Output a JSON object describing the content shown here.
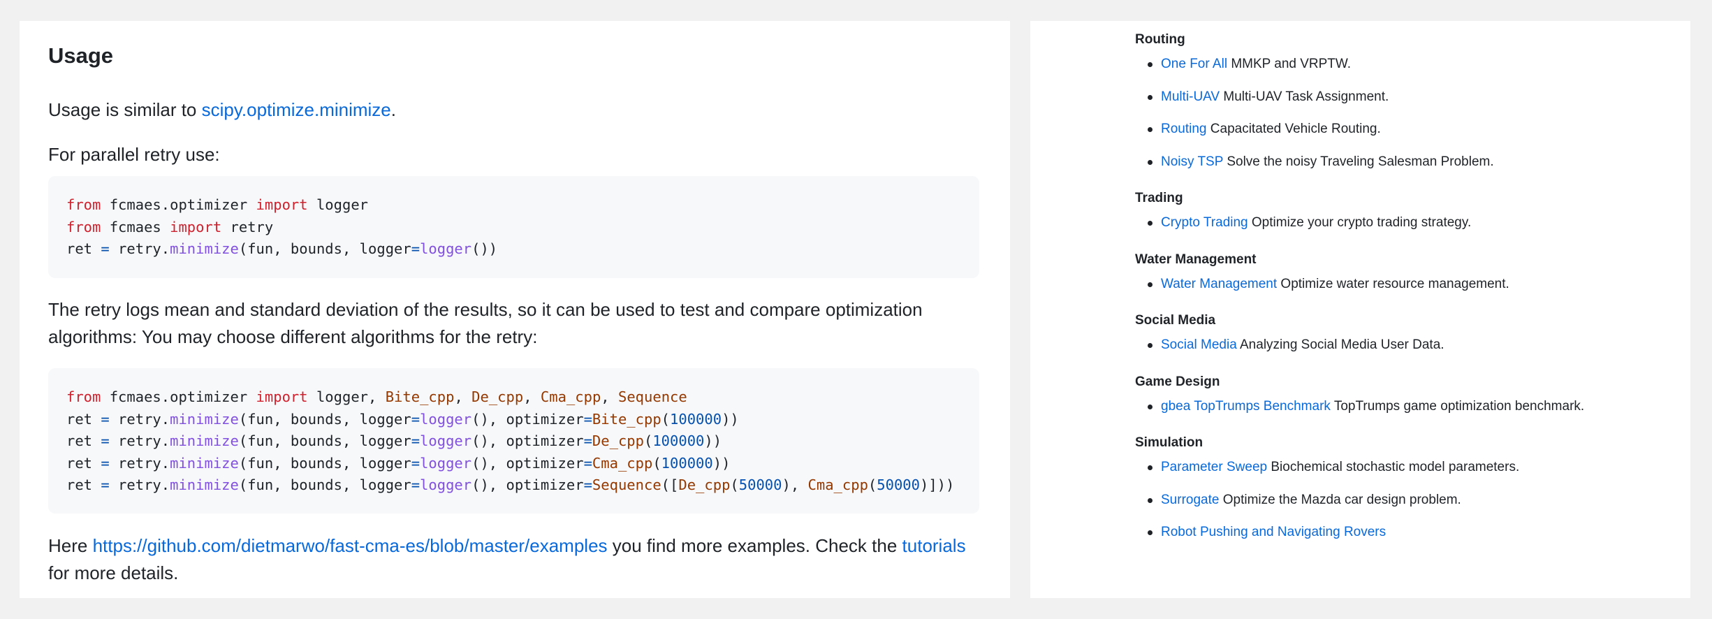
{
  "usage": {
    "title": "Usage",
    "intro_prefix": "Usage is similar to ",
    "intro_link": "scipy.optimize.minimize",
    "intro_suffix": ".",
    "parallel_text": "For parallel retry use:",
    "retry_text_line1": "The retry logs mean and standard deviation of the results, so it can be used to test and compare optimization",
    "retry_text_line2": "algorithms: You may choose different algorithms for the retry:",
    "more_prefix": "Here ",
    "more_link": "https://github.com/dietmarwo/fast-cma-es/blob/master/examples",
    "more_middle": " you find more examples. Check the ",
    "tutorials_link": "tutorials",
    "more_suffix": "for more details."
  },
  "code1": [
    [
      [
        "kw",
        "from"
      ],
      [
        "t",
        " fcmaes.optimizer "
      ],
      [
        "kw",
        "import"
      ],
      [
        "t",
        " logger"
      ]
    ],
    [
      [
        "kw",
        "from"
      ],
      [
        "t",
        " fcmaes "
      ],
      [
        "kw",
        "import"
      ],
      [
        "t",
        " retry"
      ]
    ],
    [
      [
        "t",
        "ret "
      ],
      [
        "op",
        "="
      ],
      [
        "t",
        " retry."
      ],
      [
        "fn",
        "minimize"
      ],
      [
        "t",
        "(fun, bounds, logger"
      ],
      [
        "op",
        "="
      ],
      [
        "fn",
        "logger"
      ],
      [
        "t",
        "())"
      ]
    ]
  ],
  "code2": [
    [
      [
        "kw",
        "from"
      ],
      [
        "t",
        " fcmaes.optimizer "
      ],
      [
        "kw",
        "import"
      ],
      [
        "t",
        " logger, "
      ],
      [
        "cls",
        "Bite_cpp"
      ],
      [
        "t",
        ", "
      ],
      [
        "cls",
        "De_cpp"
      ],
      [
        "t",
        ", "
      ],
      [
        "cls",
        "Cma_cpp"
      ],
      [
        "t",
        ", "
      ],
      [
        "cls",
        "Sequence"
      ]
    ],
    [
      [
        "t",
        "ret "
      ],
      [
        "op",
        "="
      ],
      [
        "t",
        " retry."
      ],
      [
        "fn",
        "minimize"
      ],
      [
        "t",
        "(fun, bounds, logger"
      ],
      [
        "op",
        "="
      ],
      [
        "fn",
        "logger"
      ],
      [
        "t",
        "(), optimizer"
      ],
      [
        "op",
        "="
      ],
      [
        "cls",
        "Bite_cpp"
      ],
      [
        "t",
        "("
      ],
      [
        "num",
        "100000"
      ],
      [
        "t",
        "))"
      ]
    ],
    [
      [
        "t",
        "ret "
      ],
      [
        "op",
        "="
      ],
      [
        "t",
        " retry."
      ],
      [
        "fn",
        "minimize"
      ],
      [
        "t",
        "(fun, bounds, logger"
      ],
      [
        "op",
        "="
      ],
      [
        "fn",
        "logger"
      ],
      [
        "t",
        "(), optimizer"
      ],
      [
        "op",
        "="
      ],
      [
        "cls",
        "De_cpp"
      ],
      [
        "t",
        "("
      ],
      [
        "num",
        "100000"
      ],
      [
        "t",
        "))"
      ]
    ],
    [
      [
        "t",
        "ret "
      ],
      [
        "op",
        "="
      ],
      [
        "t",
        " retry."
      ],
      [
        "fn",
        "minimize"
      ],
      [
        "t",
        "(fun, bounds, logger"
      ],
      [
        "op",
        "="
      ],
      [
        "fn",
        "logger"
      ],
      [
        "t",
        "(), optimizer"
      ],
      [
        "op",
        "="
      ],
      [
        "cls",
        "Cma_cpp"
      ],
      [
        "t",
        "("
      ],
      [
        "num",
        "100000"
      ],
      [
        "t",
        "))"
      ]
    ],
    [
      [
        "t",
        "ret "
      ],
      [
        "op",
        "="
      ],
      [
        "t",
        " retry."
      ],
      [
        "fn",
        "minimize"
      ],
      [
        "t",
        "(fun, bounds, logger"
      ],
      [
        "op",
        "="
      ],
      [
        "fn",
        "logger"
      ],
      [
        "t",
        "(), optimizer"
      ],
      [
        "op",
        "="
      ],
      [
        "cls",
        "Sequence"
      ],
      [
        "t",
        "(["
      ],
      [
        "cls",
        "De_cpp"
      ],
      [
        "t",
        "("
      ],
      [
        "num",
        "50000"
      ],
      [
        "t",
        "), "
      ],
      [
        "cls",
        "Cma_cpp"
      ],
      [
        "t",
        "("
      ],
      [
        "num",
        "50000"
      ],
      [
        "t",
        ")]))"
      ]
    ]
  ],
  "categories": [
    {
      "title": "Routing",
      "items": [
        {
          "link": "One For All",
          "text": " MMKP and VRPTW."
        },
        {
          "link": "Multi-UAV",
          "text": " Multi-UAV Task Assignment."
        },
        {
          "link": "Routing",
          "text": " Capacitated Vehicle Routing."
        },
        {
          "link": "Noisy TSP",
          "text": " Solve the noisy Traveling Salesman Problem."
        }
      ]
    },
    {
      "title": "Trading",
      "items": [
        {
          "link": "Crypto Trading",
          "text": " Optimize your crypto trading strategy."
        }
      ]
    },
    {
      "title": "Water Management",
      "items": [
        {
          "link": "Water Management",
          "text": " Optimize water resource management."
        }
      ]
    },
    {
      "title": "Social Media",
      "items": [
        {
          "link": "Social Media",
          "text": " Analyzing Social Media User Data."
        }
      ]
    },
    {
      "title": "Game Design",
      "items": [
        {
          "link": "gbea TopTrumps Benchmark",
          "text": " TopTrumps game optimization benchmark."
        }
      ]
    },
    {
      "title": "Simulation",
      "items": [
        {
          "link": "Parameter Sweep",
          "text": " Biochemical stochastic model parameters."
        },
        {
          "link": "Surrogate",
          "text": " Optimize the Mazda car design problem."
        },
        {
          "link": "Robot Pushing and Navigating Rovers",
          "text": ""
        }
      ]
    }
  ]
}
